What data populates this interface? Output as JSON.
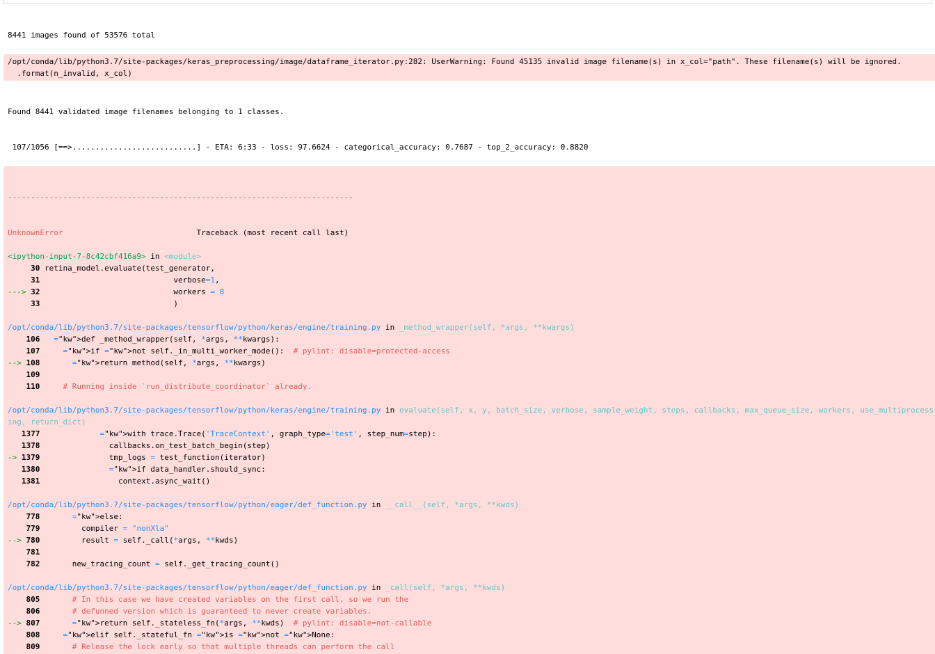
{
  "output": {
    "line1": "8441 images found of 53576 total",
    "warning_line1": "/opt/conda/lib/python3.7/site-packages/keras_preprocessing/image/dataframe_iterator.py:282: UserWarning: Found 45135 invalid image filename(s) in x_col=\"path\". These filename(s) will be ignored.",
    "warning_line2": "  .format(n_invalid, x_col)",
    "found_line": "Found 8441 validated image filenames belonging to 1 classes.",
    "progress_line": " 107/1056 [==>...........................] - ETA: 6:33 - loss: 97.6624 - categorical_accuracy: 0.7687 - top_2_accuracy: 0.8820"
  },
  "traceback": {
    "dashes": "---------------------------------------------------------------------------",
    "error_name": "UnknownError",
    "traceback_label": "                             Traceback (most recent call last)",
    "frame1": {
      "file": "<ipython-input-7-8c42cbf416a9>",
      "in_word": " in ",
      "func": "<module>",
      "lines": [
        {
          "marker": "     ",
          "num": "30",
          "code": "retina_model.evaluate(test_generator,"
        },
        {
          "marker": "     ",
          "num": "31",
          "code": "                            verbose=1,"
        },
        {
          "marker": "---> ",
          "num": "32",
          "code": "                            workers = 8"
        },
        {
          "marker": "     ",
          "num": "33",
          "code": "                            )"
        }
      ]
    },
    "frame2": {
      "file": "/opt/conda/lib/python3.7/site-packages/tensorflow/python/keras/engine/training.py",
      "in_word": " in ",
      "func": "_method_wrapper(self, *args, **kwargs)",
      "lines": [
        {
          "marker": "    ",
          "num": "106",
          "code": "  def _method_wrapper(self, *args, **kwargs):"
        },
        {
          "marker": "    ",
          "num": "107",
          "code": "    if not self._in_multi_worker_mode():  # pylint: disable=protected-access"
        },
        {
          "marker": "--> ",
          "num": "108",
          "code": "      return method(self, *args, **kwargs)"
        },
        {
          "marker": "    ",
          "num": "109",
          "code": ""
        },
        {
          "marker": "    ",
          "num": "110",
          "code": "    # Running inside `run_distribute_coordinator` already."
        }
      ]
    },
    "frame3": {
      "file": "/opt/conda/lib/python3.7/site-packages/tensorflow/python/keras/engine/training.py",
      "in_word": " in ",
      "func": "evaluate(self, x, y, batch_size, verbose, sample_weight, steps, callbacks, max_queue_size, workers, use_multiprocessing, return_dict)",
      "lines": [
        {
          "marker": "   ",
          "num": "1377",
          "code": "            with trace.Trace('TraceContext', graph_type='test', step_num=step):"
        },
        {
          "marker": "   ",
          "num": "1378",
          "code": "              callbacks.on_test_batch_begin(step)"
        },
        {
          "marker": "-> ",
          "num": "1379",
          "code": "              tmp_logs = test_function(iterator)"
        },
        {
          "marker": "   ",
          "num": "1380",
          "code": "              if data_handler.should_sync:"
        },
        {
          "marker": "   ",
          "num": "1381",
          "code": "                context.async_wait()"
        }
      ]
    },
    "frame4": {
      "file": "/opt/conda/lib/python3.7/site-packages/tensorflow/python/eager/def_function.py",
      "in_word": " in ",
      "func": "__call__(self, *args, **kwds)",
      "lines": [
        {
          "marker": "    ",
          "num": "778",
          "code": "      else:"
        },
        {
          "marker": "    ",
          "num": "779",
          "code": "        compiler = \"nonXla\""
        },
        {
          "marker": "--> ",
          "num": "780",
          "code": "        result = self._call(*args, **kwds)"
        },
        {
          "marker": "    ",
          "num": "781",
          "code": ""
        },
        {
          "marker": "    ",
          "num": "782",
          "code": "      new_tracing_count = self._get_tracing_count()"
        }
      ]
    },
    "frame5": {
      "file": "/opt/conda/lib/python3.7/site-packages/tensorflow/python/eager/def_function.py",
      "in_word": " in ",
      "func": "_call(self, *args, **kwds)",
      "lines": [
        {
          "marker": "    ",
          "num": "805",
          "code": "      # In this case we have created variables on the first call, so we run the"
        },
        {
          "marker": "    ",
          "num": "806",
          "code": "      # defunned version which is guaranteed to never create variables."
        },
        {
          "marker": "--> ",
          "num": "807",
          "code": "      return self._stateless_fn(*args, **kwds)  # pylint: disable=not-callable"
        },
        {
          "marker": "    ",
          "num": "808",
          "code": "    elif self._stateful_fn is not None:"
        },
        {
          "marker": "    ",
          "num": "809",
          "code": "      # Release the lock early so that multiple threads can perform the call"
        }
      ]
    }
  }
}
